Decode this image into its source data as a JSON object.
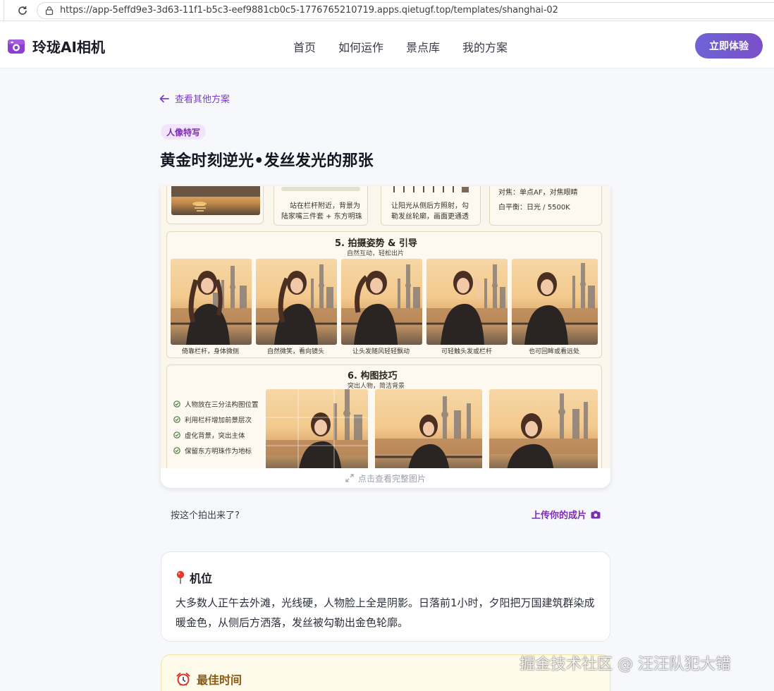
{
  "browser": {
    "url": "https://app-5effd9e3-3d63-11f1-b5c3-eef9881cb0c5-1776765210719.apps.qietugf.top/templates/shanghai-02"
  },
  "header": {
    "brand": "玲珑AI相机",
    "nav": [
      "首页",
      "如何运作",
      "景点库",
      "我的方案"
    ],
    "cta": "立即体验"
  },
  "page": {
    "back_link": "查看其他方案",
    "tag": "人像特写",
    "title": "黄金时刻逆光•发丝发光的那张"
  },
  "guide_image": {
    "top_captions": [
      "站在栏杆附近，背景为",
      "陆家嘴三件套 + 东方明珠",
      "让阳光从侧后方照射，勾",
      "勒发丝轮廓，画面更通透",
      "对焦：单点AF，对焦眼睛",
      "白平衡：日光 / 5500K"
    ],
    "section5": {
      "title": "5. 拍摄姿势 & 引导",
      "subtitle": "自然互动，轻松出片",
      "poses": [
        "倚靠栏杆，身体微侧",
        "自然微笑，看向镜头",
        "让头发随风轻轻飘动",
        "可轻触头发或栏杆",
        "也可回眸或看远处"
      ]
    },
    "section6": {
      "title": "6. 构图技巧",
      "subtitle": "突出人物，简洁背景",
      "tips": [
        "人物放在三分法构图位置",
        "利用栏杆增加前景层次",
        "虚化背景，突出主体",
        "保留东方明珠作为地标"
      ]
    },
    "expand_hint": "点击查看完整图片"
  },
  "upload": {
    "question": "按这个拍出来了?",
    "link": "上传你的成片"
  },
  "position_card": {
    "title": "机位",
    "body": "大多数人正午去外滩，光线硬，人物脸上全是阴影。日落前1小时，夕阳把万国建筑群染成暖金色，从侧后方洒落，发丝被勾勒出金色轮廓。"
  },
  "time_card": {
    "title": "最佳时间"
  },
  "watermark": "掘金技术社区 @ 汪汪队犯大错",
  "colors": {
    "accent": "#7b2fb0",
    "cta_start": "#6d63d6",
    "cta_end": "#7a4fc9"
  }
}
